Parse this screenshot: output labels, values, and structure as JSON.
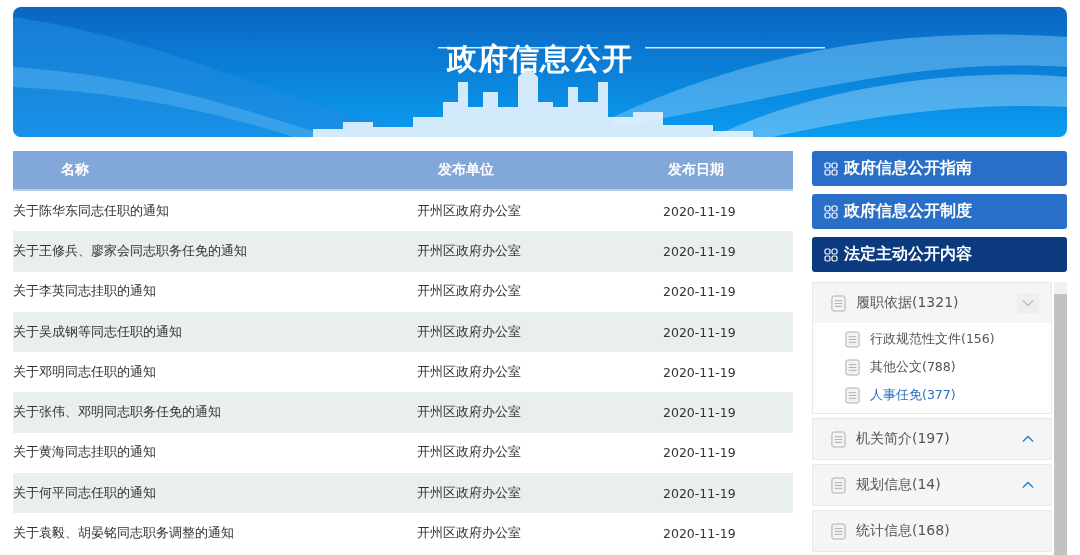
{
  "banner": {
    "title": "政府信息公开"
  },
  "table": {
    "columns": [
      "名称",
      "发布单位",
      "发布日期"
    ],
    "rows": [
      {
        "name": "关于陈华东同志任职的通知",
        "unit": "开州区政府办公室",
        "date": "2020-11-19"
      },
      {
        "name": "关于王修兵、廖家会同志职务任免的通知",
        "unit": "开州区政府办公室",
        "date": "2020-11-19"
      },
      {
        "name": "关于李英同志挂职的通知",
        "unit": "开州区政府办公室",
        "date": "2020-11-19"
      },
      {
        "name": "关于吴成钢等同志任职的通知",
        "unit": "开州区政府办公室",
        "date": "2020-11-19"
      },
      {
        "name": "关于邓明同志任职的通知",
        "unit": "开州区政府办公室",
        "date": "2020-11-19"
      },
      {
        "name": "关于张伟、邓明同志职务任免的通知",
        "unit": "开州区政府办公室",
        "date": "2020-11-19"
      },
      {
        "name": "关于黄海同志挂职的通知",
        "unit": "开州区政府办公室",
        "date": "2020-11-19"
      },
      {
        "name": "关于何平同志任职的通知",
        "unit": "开州区政府办公室",
        "date": "2020-11-19"
      },
      {
        "name": "关于袁毅、胡晏铭同志职务调整的通知",
        "unit": "开州区政府办公室",
        "date": "2020-11-19"
      }
    ]
  },
  "sidebar": {
    "buttons": [
      {
        "label": "政府信息公开指南",
        "selected": false
      },
      {
        "label": "政府信息公开制度",
        "selected": false
      },
      {
        "label": "法定主动公开内容",
        "selected": true
      }
    ],
    "tree": [
      {
        "label": "履职依据(1321)",
        "expanded": true,
        "children": [
          {
            "label": "行政规范性文件(156)",
            "selected": false
          },
          {
            "label": "其他公文(788)",
            "selected": false
          },
          {
            "label": "人事任免(377)",
            "selected": true
          }
        ]
      },
      {
        "label": "机关简介(197)",
        "expanded": false
      },
      {
        "label": "规划信息(14)",
        "expanded": false
      },
      {
        "label": "统计信息(168)"
      }
    ]
  }
}
